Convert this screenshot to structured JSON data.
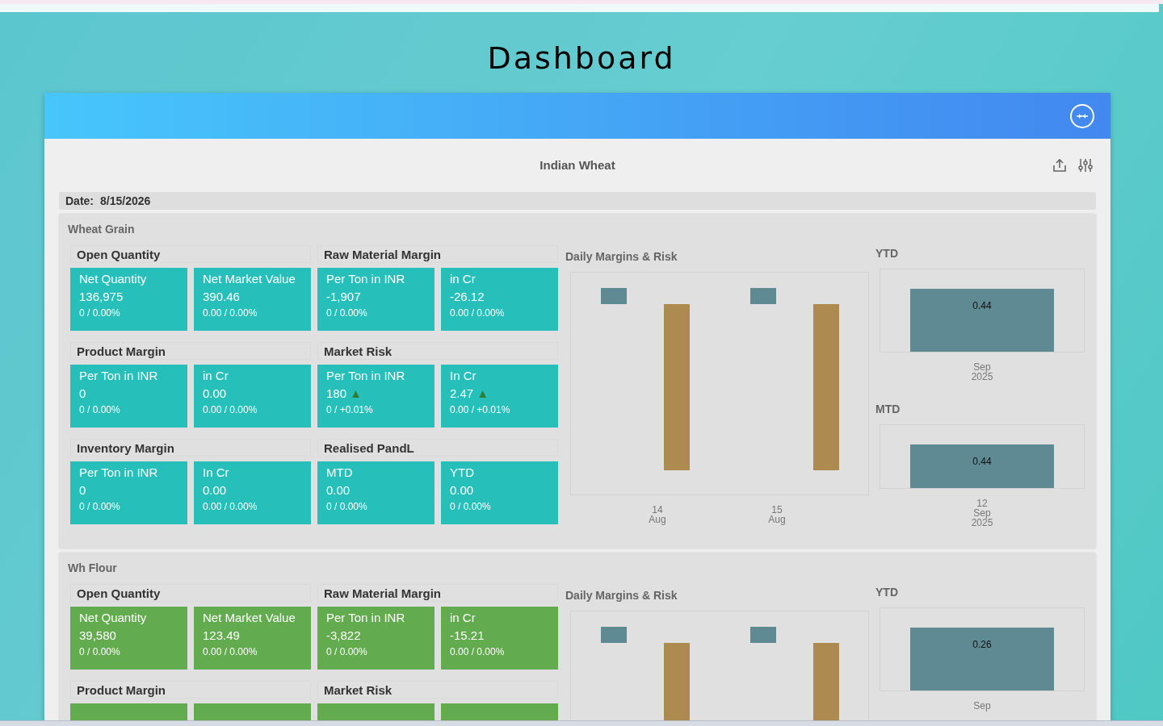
{
  "title": "Dashboard",
  "card": {
    "title": "Indian Wheat",
    "date_label": "Date:",
    "date": "8/15/2026"
  },
  "sections": [
    {
      "name": "Wheat Grain",
      "color": "#26bfba",
      "groups": [
        {
          "title": "Open Quantity",
          "tiles": [
            {
              "kind": "metric",
              "label": "Net Quantity",
              "value": "136,975",
              "change": "0 / 0.00%"
            },
            {
              "kind": "metric",
              "label": "Net Market Value",
              "value": "390.46",
              "change": "0.00 / 0.00%"
            }
          ]
        },
        {
          "title": "Raw Material Margin",
          "tiles": [
            {
              "kind": "metric",
              "label": "Per Ton in INR",
              "value": "-1,907",
              "change": "0 / 0.00%"
            },
            {
              "kind": "metric",
              "label": "in Cr",
              "value": "-26.12",
              "change": "0.00 / 0.00%"
            }
          ]
        },
        {
          "title": "Product Margin",
          "tiles": [
            {
              "kind": "metric",
              "label": "Per Ton in INR",
              "value": "0",
              "change": "0 / 0.00%"
            },
            {
              "kind": "metric",
              "label": "in Cr",
              "value": "0.00",
              "change": "0.00 / 0.00%"
            }
          ]
        },
        {
          "title": "Market Risk",
          "tiles": [
            {
              "kind": "metric",
              "label": "Per Ton in INR",
              "value": "180",
              "change": "0 / +0.01%",
              "trend": "▲"
            },
            {
              "kind": "metric",
              "label": "In Cr",
              "value": "2.47",
              "change": "0.00 / +0.01%",
              "trend": "▲"
            }
          ]
        },
        {
          "title": "Inventory Margin",
          "tiles": [
            {
              "kind": "metric",
              "label": "Per Ton in INR",
              "value": "0",
              "change": "0 / 0.00%"
            },
            {
              "kind": "metric",
              "label": "In Cr",
              "value": "0.00",
              "change": "0.00 / 0.00%"
            }
          ]
        },
        {
          "title": "Realised PandL",
          "tiles": [
            {
              "kind": "metric",
              "label": "MTD",
              "value": "0.00",
              "change": "0 / 0.00%"
            },
            {
              "kind": "metric",
              "label": "YTD",
              "value": "0.00",
              "change": "0 / 0.00%"
            }
          ]
        }
      ],
      "daily": {
        "title": "Daily Margins & Risk",
        "x_labels": [
          [
            "14",
            "Aug"
          ],
          [
            "15",
            "Aug"
          ]
        ]
      },
      "summaries": [
        {
          "title": "YTD",
          "bar_label": "0.44",
          "category": "Sep 2025"
        },
        {
          "title": "MTD",
          "bar_label": "0.44",
          "category": "12 Sep 2025"
        }
      ]
    },
    {
      "name": "Wh Flour",
      "color": "#63ab4f",
      "groups": [
        {
          "title": "Open Quantity",
          "tiles": [
            {
              "kind": "metric",
              "label": "Net Quantity",
              "value": "39,580",
              "change": "0 / 0.00%"
            },
            {
              "kind": "metric",
              "label": "Net Market Value",
              "value": "123.49",
              "change": "0.00 / 0.00%"
            }
          ]
        },
        {
          "title": "Raw Material Margin",
          "tiles": [
            {
              "kind": "metric",
              "label": "Per Ton in INR",
              "value": "-3,822",
              "change": "0 / 0.00%"
            },
            {
              "kind": "metric",
              "label": "in Cr",
              "value": "-15.21",
              "change": "0.00 / 0.00%"
            }
          ]
        },
        {
          "title": "Product Margin",
          "tiles": [
            {
              "kind": "clipped"
            },
            {
              "kind": "clipped"
            }
          ]
        },
        {
          "title": "Market Risk",
          "tiles": [
            {
              "kind": "clipped"
            },
            {
              "kind": "clipped"
            }
          ]
        }
      ],
      "daily": {
        "title": "Daily Margins & Risk"
      },
      "summaries": [
        {
          "title": "YTD",
          "bar_label": "0.26",
          "category": "Sep"
        }
      ]
    }
  ]
}
